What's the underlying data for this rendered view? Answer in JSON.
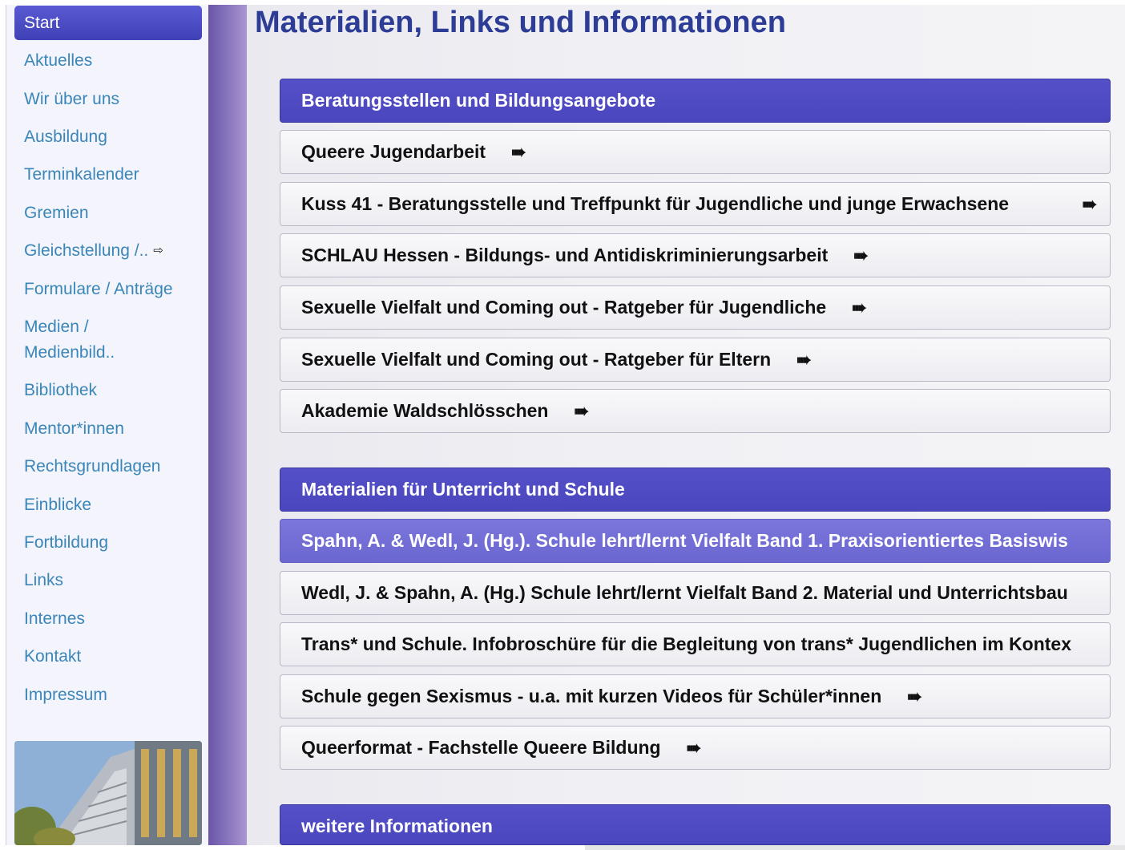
{
  "nav": {
    "items": [
      {
        "label": "Start",
        "active": true
      },
      {
        "label": "Aktuelles"
      },
      {
        "label": "Wir über uns"
      },
      {
        "label": "Ausbildung"
      },
      {
        "label": "Terminkalender"
      },
      {
        "label": "Gremien"
      },
      {
        "label": "Gleichstellung /..",
        "external": true
      },
      {
        "label": "Formulare / Anträge"
      },
      {
        "label": "Medien /"
      },
      {
        "label": "Medienbild.."
      },
      {
        "label": "Bibliothek"
      },
      {
        "label": "Mentor*innen"
      },
      {
        "label": "Rechtsgrundlagen"
      },
      {
        "label": "Einblicke"
      },
      {
        "label": "Fortbildung"
      },
      {
        "label": "Links"
      },
      {
        "label": "Internes"
      },
      {
        "label": "Kontakt"
      },
      {
        "label": "Impressum"
      }
    ],
    "external_icon": "⇨",
    "photo_icon": "building-photo"
  },
  "main": {
    "title": "Materialien, Links und Informationen",
    "arrow_glyph": "➠",
    "sections": [
      {
        "header": "Beratungsstellen und Bildungsangebote",
        "links": [
          "Queere Jugendarbeit",
          "Kuss 41 - Beratungsstelle und Treffpunkt für Jugendliche und junge Erwachsene",
          "SCHLAU Hessen - Bildungs- und Antidiskriminierungsarbeit",
          "Sexuelle Vielfalt und Coming out - Ratgeber für Jugendliche",
          "Sexuelle Vielfalt und Coming out - Ratgeber für Eltern",
          "Akademie Waldschlösschen"
        ]
      },
      {
        "header": "Materialien für Unterricht und Schule",
        "links": [
          "Spahn, A. & Wedl, J. (Hg.). Schule lehrt/lernt Vielfalt Band 1. Praxisorientiertes Basiswis",
          "Wedl, J. & Spahn, A. (Hg.) Schule lehrt/lernt Vielfalt Band 2. Material und Unterrichtsbau",
          "Trans* und Schule. Infobroschüre für die Begleitung von trans* Jugendlichen im Kontex",
          "Schule gegen Sexismus - u.a. mit kurzen Videos für Schüler*innen",
          "Queerformat - Fachstelle Queere Bildung"
        ]
      },
      {
        "header": "weitere Informationen",
        "links": []
      }
    ]
  },
  "colors": {
    "accent": "#4a46bd",
    "title": "#2d3d96",
    "nav_link": "#3a86b8"
  }
}
